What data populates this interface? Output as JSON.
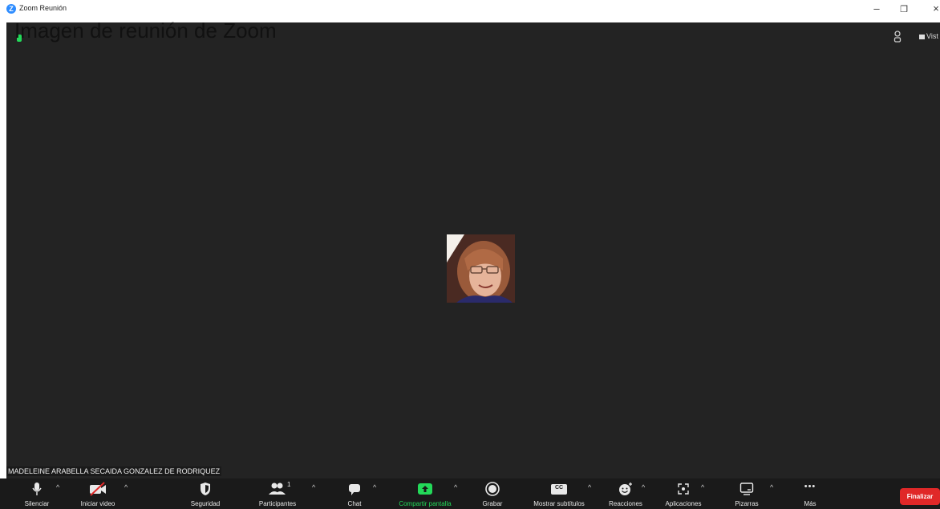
{
  "window": {
    "title": "Zoom Reunión",
    "app_icon_glyph": "Z",
    "minimize_glyph": "–",
    "restore_glyph": "❐",
    "close_glyph": "×"
  },
  "overlay_caption": "Imagen de reunión de Zoom",
  "meeting": {
    "view_label": "Vist",
    "participant_name": "MADELEINE ARABELLA SECAIDA GONZALEZ DE RODRIQUEZ"
  },
  "toolbar": {
    "mute": "Silenciar",
    "video": "Iniciar video",
    "security": "Seguridad",
    "participants": "Participantes",
    "participants_count": "1",
    "chat": "Chat",
    "share": "Compartir pantalla",
    "record": "Grabar",
    "captions": "Mostrar subtítulos",
    "captions_icon_text": "CC",
    "reactions": "Reacciones",
    "apps": "Aplicaciones",
    "whiteboards": "Pizarras",
    "more": "Más",
    "more_glyph": "•••",
    "caret_glyph": "^",
    "end": "Finalizar"
  },
  "colors": {
    "accent_green": "#23D959",
    "end_red": "#E02828",
    "zoom_blue": "#2D8CFF",
    "meeting_bg": "#232323"
  }
}
